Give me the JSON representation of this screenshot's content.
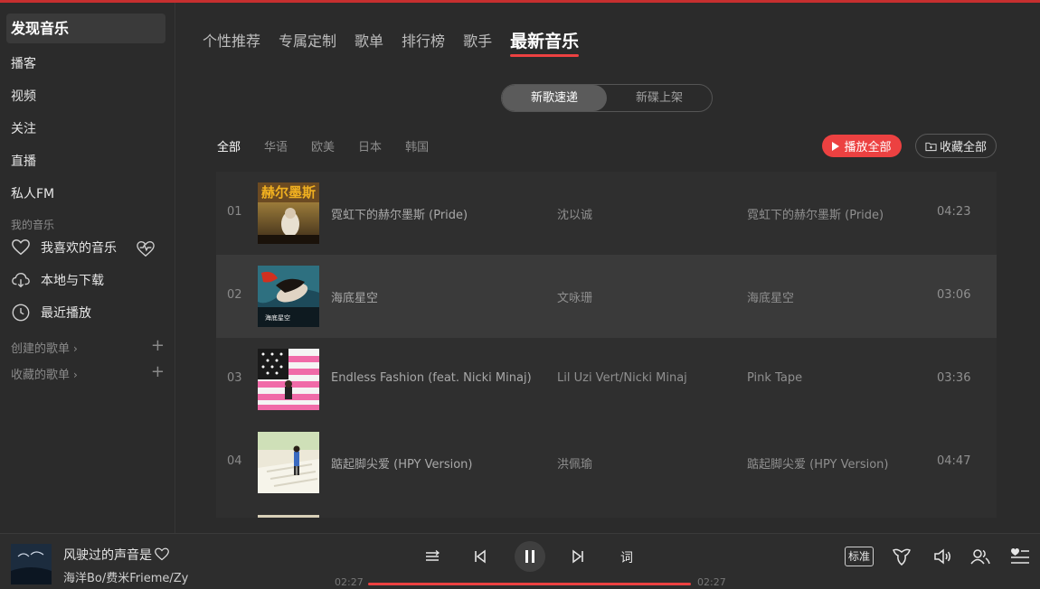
{
  "sidebar": {
    "active": "发现音乐",
    "nav": [
      "播客",
      "视频",
      "关注",
      "直播",
      "私人FM"
    ],
    "my_music_label": "我的音乐",
    "my_music": [
      "我喜欢的音乐",
      "本地与下载",
      "最近播放"
    ],
    "created_playlists": "创建的歌单",
    "collected_playlists": "收藏的歌单"
  },
  "tabs": [
    "个性推荐",
    "专属定制",
    "歌单",
    "排行榜",
    "歌手",
    "最新音乐"
  ],
  "active_tab": "最新音乐",
  "segment": {
    "left": "新歌速递",
    "right": "新碟上架",
    "active": "新歌速递"
  },
  "filters": [
    "全部",
    "华语",
    "欧美",
    "日本",
    "韩国"
  ],
  "active_filter": "全部",
  "actions": {
    "play_all": "播放全部",
    "collect_all": "收藏全部"
  },
  "songs": [
    {
      "num": "01",
      "name": "霓虹下的赫尔墨斯 (Pride)",
      "artist": "沈以诚",
      "album": "霓虹下的赫尔墨斯 (Pride)",
      "duration": "04:23",
      "cover_text": "赫尔墨斯"
    },
    {
      "num": "02",
      "name": "海底星空",
      "artist": "文咏珊",
      "album": "海底星空",
      "duration": "03:06",
      "cover_text": "海底星空"
    },
    {
      "num": "03",
      "name": "Endless Fashion (feat. Nicki Minaj)",
      "artist": "Lil Uzi Vert/Nicki Minaj",
      "album": "Pink Tape",
      "duration": "03:36"
    },
    {
      "num": "04",
      "name": "踮起脚尖爱 (HPY Version)",
      "artist": "洪佩瑜",
      "album": "踮起脚尖爱 (HPY Version)",
      "duration": "04:47"
    }
  ],
  "player": {
    "title": "风驶过的声音是",
    "artist": "海洋Bo/费米Frieme/Zy",
    "current_time": "02:27",
    "total_time": "02:27",
    "lyric": "词",
    "quality": "标准",
    "progress": 1.0
  },
  "colors": {
    "accent": "#ec4141",
    "background": "#2b2b2b"
  }
}
